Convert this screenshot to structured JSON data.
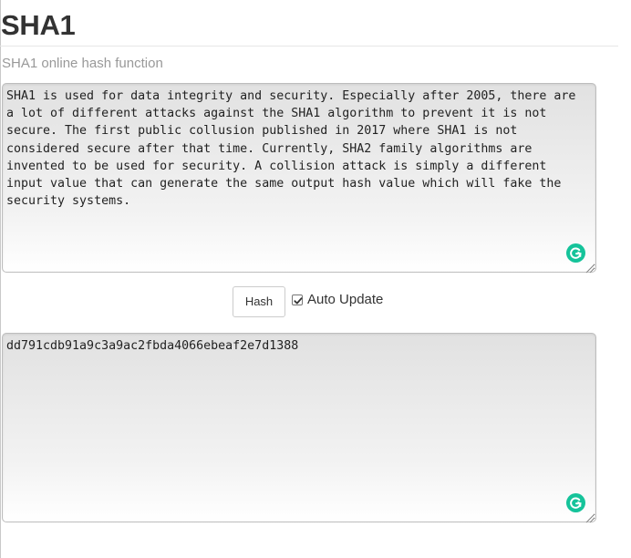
{
  "page": {
    "title": "SHA1",
    "subtitle": "SHA1 online hash function"
  },
  "input": {
    "value": "SHA1 is used for data integrity and security. Especially after 2005, there are a lot of different attacks against the SHA1 algorithm to prevent it is not secure. The first public collusion published in 2017 where SHA1 is not considered secure after that time. Currently, SHA2 family algorithms are invented to be used for security. A collision attack is simply a different input value that can generate the same output hash value which will fake the security systems."
  },
  "controls": {
    "hash_label": "Hash",
    "auto_update_label": "Auto Update",
    "auto_update_checked": true
  },
  "output": {
    "value": "dd791cdb91a9c3a9ac2fbda4066ebeaf2e7d1388"
  },
  "colors": {
    "grammarly": "#15c39a",
    "title": "#333333",
    "subtitle": "#999999"
  },
  "icons": [
    "grammarly-icon",
    "resize-grip-icon",
    "checkmark-icon"
  ]
}
